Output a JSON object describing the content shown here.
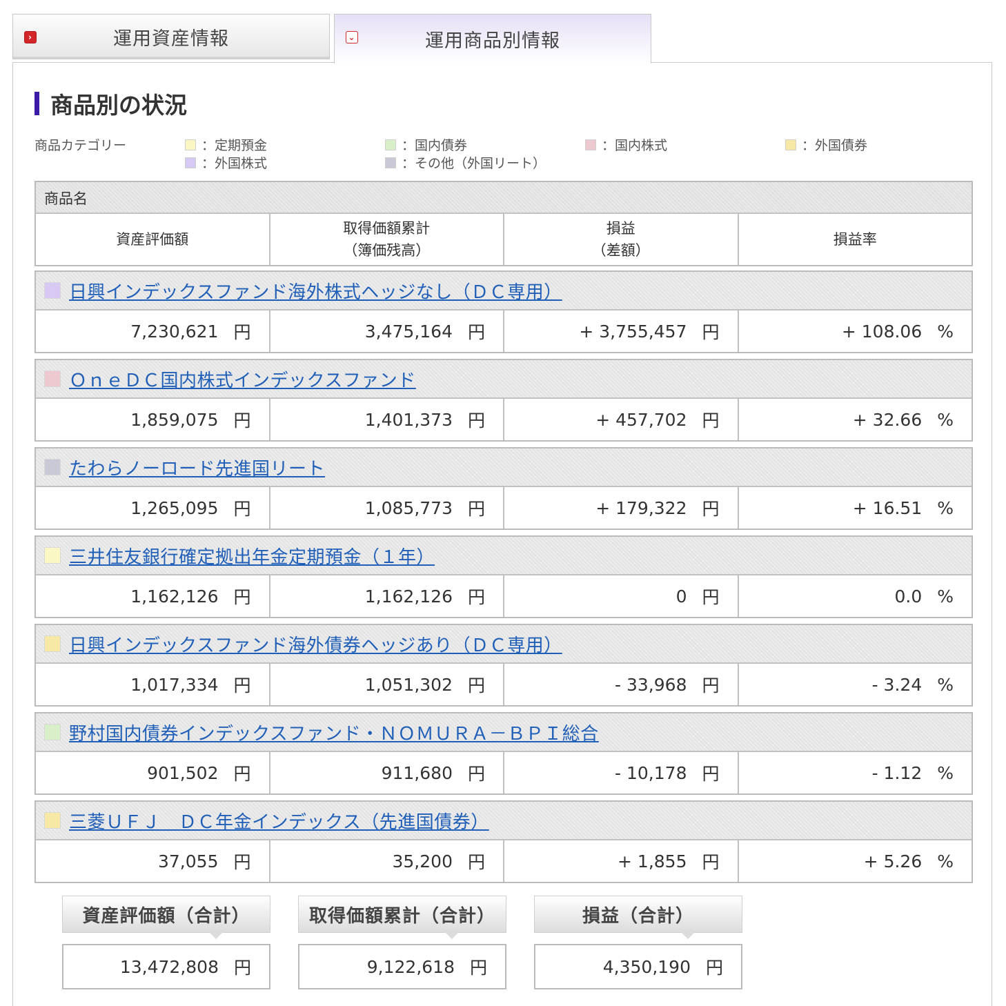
{
  "tabs": [
    {
      "label": "運用資産情報",
      "active": false
    },
    {
      "label": "運用商品別情報",
      "active": true
    }
  ],
  "section_title": "商品別の状況",
  "category_label": "商品カテゴリー",
  "legend": [
    {
      "label": "：定期預金",
      "color": "#fbf7c4"
    },
    {
      "label": "：国内債券",
      "color": "#d8efc9"
    },
    {
      "label": "：国内株式",
      "color": "#efc9d0"
    },
    {
      "label": "：外国債券",
      "color": "#f7e8a6"
    },
    {
      "label": "：外国株式",
      "color": "#d8c8f4"
    },
    {
      "label": "：その他（外国リート）",
      "color": "#c9c9d8"
    }
  ],
  "table_header": {
    "name": "商品名",
    "col1": "資産評価額",
    "col2_line1": "取得価額累計",
    "col2_line2": "（簿価残高）",
    "col3_line1": "損益",
    "col3_line2": "（差額）",
    "col4": "損益率"
  },
  "units": {
    "yen": "円",
    "pct": "%"
  },
  "funds": [
    {
      "name": "日興インデックスファンド海外株式ヘッジなし（ＤＣ専用）",
      "color": "#d8c8f4",
      "value": "7,230,621",
      "cost": "3,475,164",
      "pl": "+ 3,755,457",
      "rate": "+ 108.06"
    },
    {
      "name": "ＯｎｅＤＣ国内株式インデックスファンド",
      "color": "#efc9d0",
      "value": "1,859,075",
      "cost": "1,401,373",
      "pl": "+ 457,702",
      "rate": "+ 32.66"
    },
    {
      "name": "たわらノーロード先進国リート",
      "color": "#c9c9d8",
      "value": "1,265,095",
      "cost": "1,085,773",
      "pl": "+ 179,322",
      "rate": "+ 16.51"
    },
    {
      "name": "三井住友銀行確定拠出年金定期預金（１年）",
      "color": "#fbf7c4",
      "value": "1,162,126",
      "cost": "1,162,126",
      "pl": "0",
      "rate": "0.0"
    },
    {
      "name": "日興インデックスファンド海外債券ヘッジあり（ＤＣ専用）",
      "color": "#f7e8a6",
      "value": "1,017,334",
      "cost": "1,051,302",
      "pl": "- 33,968",
      "rate": "- 3.24"
    },
    {
      "name": "野村国内債券インデックスファンド・ＮＯＭＵＲＡ－ＢＰＩ総合",
      "color": "#d8efc9",
      "value": "901,502",
      "cost": "911,680",
      "pl": "- 10,178",
      "rate": "- 1.12"
    },
    {
      "name": "三菱ＵＦＪ　ＤＣ年金インデックス（先進国債券）",
      "color": "#f7e8a6",
      "value": "37,055",
      "cost": "35,200",
      "pl": "+ 1,855",
      "rate": "+ 5.26"
    }
  ],
  "totals": [
    {
      "label": "資産評価額（合計）",
      "value": "13,472,808"
    },
    {
      "label": "取得価額累計（合計）",
      "value": "9,122,618"
    },
    {
      "label": "損益（合計）",
      "value": "4,350,190"
    }
  ]
}
